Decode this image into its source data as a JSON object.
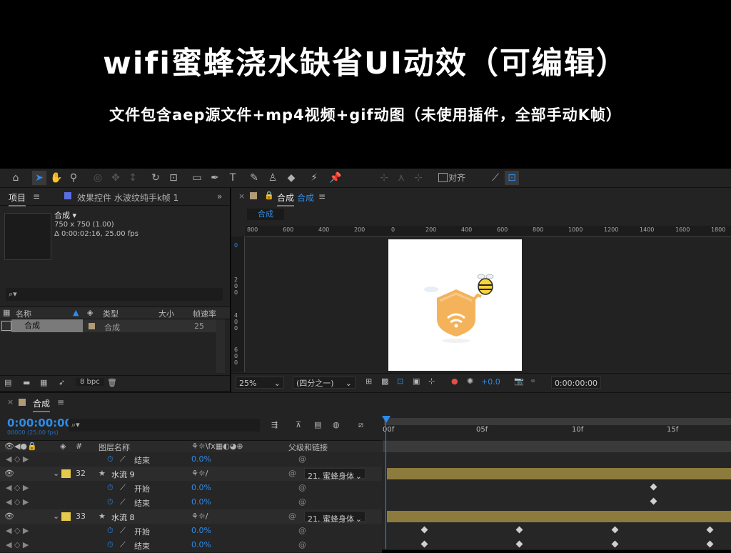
{
  "banner": {
    "title": "wifi蜜蜂浇水缺省UI动效（可编辑）",
    "subtitle": "文件包含aep源文件+mp4视频+gif动图（未使用插件，全部手动K帧）"
  },
  "toolbar": {
    "icons": [
      "home-icon",
      "selection-icon",
      "hand-icon",
      "zoom-icon",
      "rotate-icon",
      "camera-orbit-icon",
      "pan-icon",
      "dolly-icon",
      "rotation-tool-icon",
      "anchor-icon",
      "rectangle-icon",
      "pen-icon",
      "text-icon",
      "brush-icon",
      "clone-stamp-icon",
      "eraser-icon",
      "roto-brush-icon",
      "puppet-pin-icon"
    ],
    "align_label": "对齐"
  },
  "project_panel": {
    "tab_project": "项目",
    "tab_effects": "效果控件 水波纹纯手k帧 1",
    "comp_name": "合成",
    "comp_size": "750 x 750 (1.00)",
    "comp_duration": "Δ 0:00:02:16, 25.00 fps",
    "search_placeholder": "⌕▾",
    "columns": {
      "name": "名称",
      "type": "类型",
      "size": "大小",
      "fps": "帧速率"
    },
    "items": [
      {
        "name": "合成",
        "type": "合成",
        "fps": "25"
      }
    ],
    "bpc": "8 bpc"
  },
  "comp_panel": {
    "tab_label": "合成",
    "tab_link": "合成",
    "comp_button": "合成",
    "ruler_h": [
      "800",
      "600",
      "400",
      "200",
      "0",
      "200",
      "400",
      "600",
      "800",
      "1000",
      "1200",
      "1400",
      "1600",
      "1800"
    ],
    "ruler_v": [
      "0",
      "2\n0\n0",
      "4\n0\n0",
      "6\n0\n0"
    ],
    "zoom": "25%",
    "resolution": "(四分之一)",
    "exposure": "+0.0",
    "timecode": "0:00:00:00"
  },
  "timeline": {
    "tab_label": "合成",
    "timecode": "0:00:00:00",
    "fps_info": "00000 (25.00 fps)",
    "search_placeholder": "⌕▾",
    "col_hash": "#",
    "col_layer_name": "图层名称",
    "col_parent": "父级和链接",
    "ruler_labels": [
      "00f",
      "05f",
      "10f",
      "15f"
    ],
    "rows": [
      {
        "kind": "prop",
        "name": "结束",
        "value": "0.0%"
      },
      {
        "kind": "layer",
        "num": "32",
        "name": "水流 9",
        "parent": "21. 蜜蜂身体"
      },
      {
        "kind": "prop",
        "name": "开始",
        "value": "0.0%"
      },
      {
        "kind": "prop",
        "name": "结束",
        "value": "0.0%"
      },
      {
        "kind": "layer",
        "num": "33",
        "name": "水流 8",
        "parent": "21. 蜜蜂身体"
      },
      {
        "kind": "prop",
        "name": "开始",
        "value": "0.0%"
      },
      {
        "kind": "prop",
        "name": "结束",
        "value": "0.0%"
      }
    ]
  },
  "colors": {
    "accent": "#2d8ceb",
    "label_yellow": "#e6c84a",
    "layer_bar": "#8c7b3c",
    "panel": "#232323"
  }
}
